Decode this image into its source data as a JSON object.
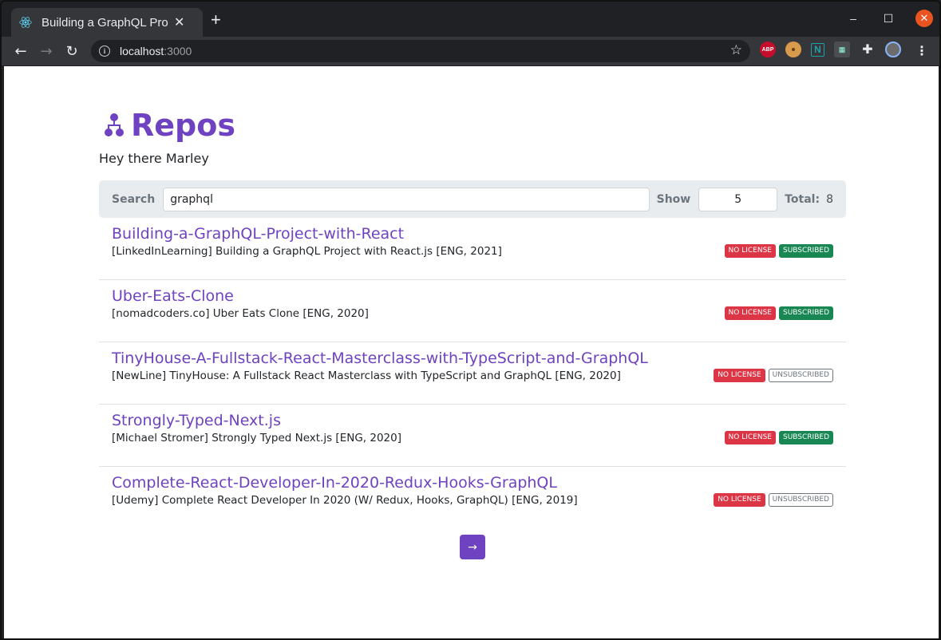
{
  "browser": {
    "tab_title": "Building a GraphQL Proje",
    "tab_close": "✕",
    "new_tab": "+",
    "url_host": "localhost",
    "url_port": ":3000",
    "ext_abp": "ABP",
    "ext_n": "N"
  },
  "page": {
    "title": "Repos",
    "greeting": "Hey there Marley",
    "accent_color": "#6f42c1"
  },
  "search": {
    "label": "Search",
    "value": "graphql",
    "show_label": "Show",
    "show_value": "5",
    "total_label": "Total:",
    "total_value": "8"
  },
  "repos": [
    {
      "name": "Building-a-GraphQL-Project-with-React",
      "description": "[LinkedInLearning] Building a GraphQL Project with React.js [ENG, 2021]",
      "license": "NO LICENSE",
      "subscription": "SUBSCRIBED"
    },
    {
      "name": "Uber-Eats-Clone",
      "description": "[nomadcoders.co] Uber Eats Clone [ENG, 2020]",
      "license": "NO LICENSE",
      "subscription": "SUBSCRIBED"
    },
    {
      "name": "TinyHouse-A-Fullstack-React-Masterclass-with-TypeScript-and-GraphQL",
      "description": "[NewLine] TinyHouse: A Fullstack React Masterclass with TypeScript and GraphQL [ENG, 2020]",
      "license": "NO LICENSE",
      "subscription": "UNSUBSCRIBED"
    },
    {
      "name": "Strongly-Typed-Next.js",
      "description": "[Michael Stromer] Strongly Typed Next.js [ENG, 2020]",
      "license": "NO LICENSE",
      "subscription": "SUBSCRIBED"
    },
    {
      "name": "Complete-React-Developer-In-2020-Redux-Hooks-GraphQL",
      "description": "[Udemy] Complete React Developer In 2020 (W/ Redux, Hooks, GraphQL) [ENG, 2019]",
      "license": "NO LICENSE",
      "subscription": "UNSUBSCRIBED"
    }
  ],
  "pagination": {
    "next_label": "→"
  }
}
